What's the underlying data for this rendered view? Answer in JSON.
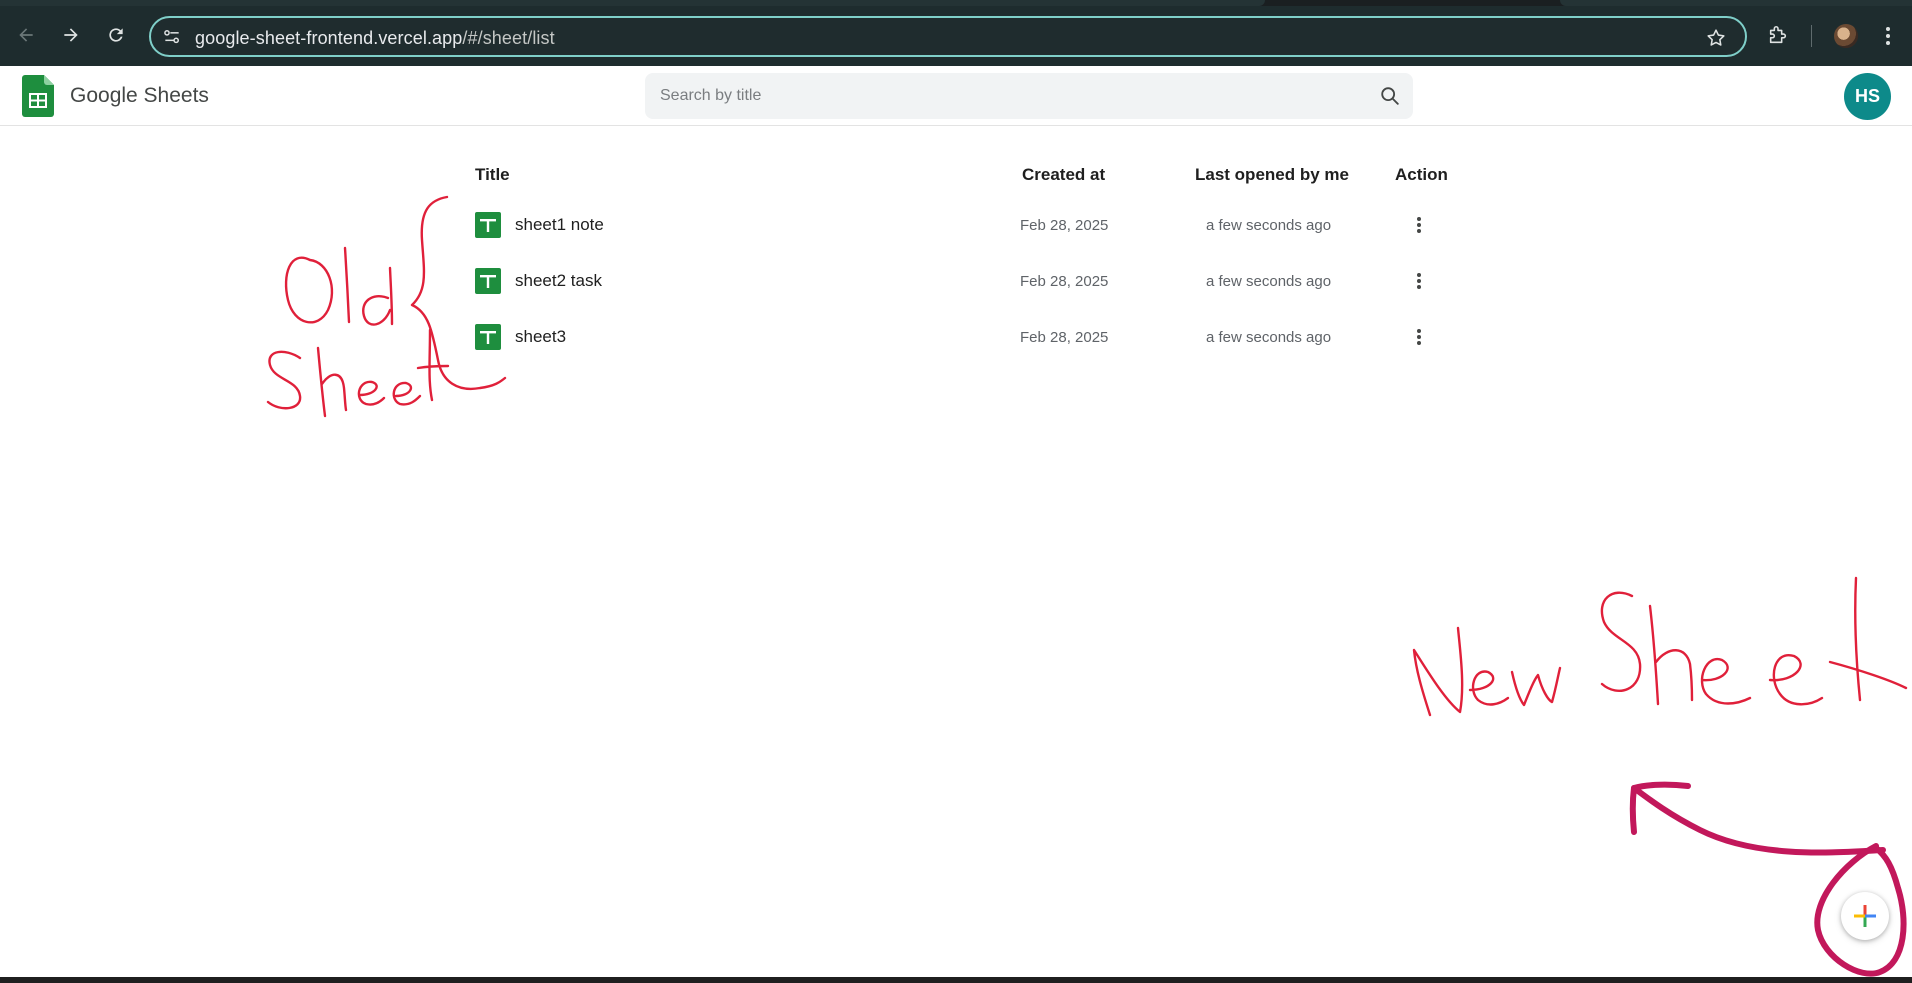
{
  "browser": {
    "url_host": "google-sheet-frontend.vercel.app",
    "url_path": "/#/sheet/list"
  },
  "header": {
    "app_title": "Google Sheets",
    "search_placeholder": "Search by title",
    "avatar_initials": "HS",
    "avatar_color": "#0d8a8a"
  },
  "table": {
    "columns": {
      "title": "Title",
      "created": "Created at",
      "opened": "Last opened by me",
      "action": "Action"
    },
    "rows": [
      {
        "title": "sheet1 note",
        "created": "Feb 28, 2025",
        "opened": "a few seconds ago"
      },
      {
        "title": "sheet2 task",
        "created": "Feb 28, 2025",
        "opened": "a few seconds ago"
      },
      {
        "title": "sheet3",
        "created": "Feb 28, 2025",
        "opened": "a few seconds ago"
      }
    ]
  },
  "icons": {
    "logo": "google-sheets-logo-icon",
    "file": "sheet-file-icon",
    "row_menu": "more-vert-icon",
    "fab": "plus-icon"
  },
  "annotations": {
    "old_sheet": "Old Sheet",
    "new_sheet": "NewSheet",
    "annotation_color": "#e0203a",
    "arrow_color": "#c2185b"
  },
  "colors": {
    "sheets_green": "#1e8e3e",
    "browser_bar": "#1e2c2e",
    "omnibox_border": "#7fcfc9"
  }
}
